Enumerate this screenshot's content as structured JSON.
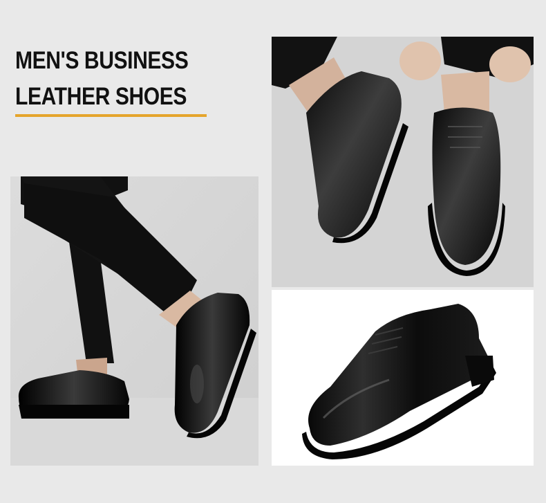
{
  "title": {
    "line1": "MEN'S BUSINESS",
    "line2": "LEATHER SHOES"
  },
  "colors": {
    "accent": "#e5a52c",
    "background": "#e9e9e9",
    "leather": "#0d0d0d",
    "trousers": "#111111"
  },
  "icons": [
    "shoe-photo-walking",
    "shoe-photo-pair",
    "shoe-photo-product"
  ]
}
